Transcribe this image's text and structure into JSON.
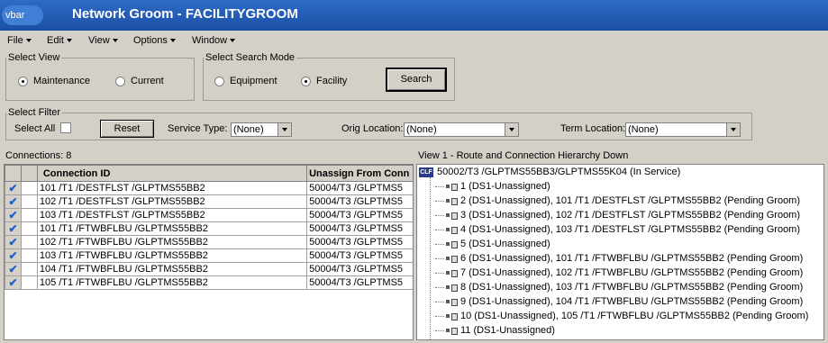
{
  "titlebar": {
    "app_badge": "vbar",
    "title": "Network Groom - FACILITYGROOM"
  },
  "menu": {
    "items": [
      "File",
      "Edit",
      "View",
      "Options",
      "Window"
    ]
  },
  "select_view": {
    "legend": "Select View",
    "options": [
      "Maintenance",
      "Current"
    ],
    "selected": "Maintenance"
  },
  "search_mode": {
    "legend": "Select Search Mode",
    "options": [
      "Equipment",
      "Facility"
    ],
    "selected": "Facility",
    "search_label": "Search"
  },
  "filter": {
    "legend": "Select Filter",
    "select_all_label": "Select All",
    "reset_label": "Reset",
    "service_type_label": "Service Type:",
    "service_type_value": "(None)",
    "orig_location_label": "Orig Location:",
    "orig_location_value": "(None)",
    "term_location_label": "Term Location:",
    "term_location_value": "(None)"
  },
  "connections": {
    "count_label": "Connections: 8",
    "columns": [
      "Connection ID",
      "Unassign From Conn"
    ],
    "rows": [
      [
        "101  /T1   /DESTFLST  /GLPTMS55BB2",
        "50004/T3    /GLPTMS5"
      ],
      [
        "102  /T1   /DESTFLST  /GLPTMS55BB2",
        "50004/T3    /GLPTMS5"
      ],
      [
        "103  /T1   /DESTFLST  /GLPTMS55BB2",
        "50004/T3    /GLPTMS5"
      ],
      [
        "101  /T1   /FTWBFLBU  /GLPTMS55BB2",
        "50004/T3    /GLPTMS5"
      ],
      [
        "102  /T1   /FTWBFLBU  /GLPTMS55BB2",
        "50004/T3    /GLPTMS5"
      ],
      [
        "103  /T1   /FTWBFLBU  /GLPTMS55BB2",
        "50004/T3    /GLPTMS5"
      ],
      [
        "104  /T1   /FTWBFLBU  /GLPTMS55BB2",
        "50004/T3    /GLPTMS5"
      ],
      [
        "105  /T1   /FTWBFLBU  /GLPTMS55BB2",
        "50004/T3    /GLPTMS5"
      ]
    ]
  },
  "hierarchy": {
    "caption": "View 1 - Route and Connection Hierarchy Down",
    "root_badge": "CLF",
    "root": "50002/T3    /GLPTMS55BB3/GLPTMS55K04 (In Service)",
    "items": [
      "1 (DS1-Unassigned)",
      "2 (DS1-Unassigned), 101  /T1    /DESTFLST    /GLPTMS55BB2 (Pending Groom)",
      "3 (DS1-Unassigned), 102  /T1    /DESTFLST    /GLPTMS55BB2 (Pending Groom)",
      "4 (DS1-Unassigned), 103  /T1    /DESTFLST    /GLPTMS55BB2 (Pending Groom)",
      "5 (DS1-Unassigned)",
      "6 (DS1-Unassigned), 101  /T1    /FTWBFLBU    /GLPTMS55BB2 (Pending Groom)",
      "7 (DS1-Unassigned), 102  /T1    /FTWBFLBU    /GLPTMS55BB2 (Pending Groom)",
      "8 (DS1-Unassigned), 103  /T1    /FTWBFLBU    /GLPTMS55BB2 (Pending Groom)",
      "9 (DS1-Unassigned), 104  /T1    /FTWBFLBU    /GLPTMS55BB2 (Pending Groom)",
      "10 (DS1-Unassigned), 105  /T1    /FTWBFLBU    /GLPTMS55BB2 (Pending Groom)",
      "11 (DS1-Unassigned)"
    ]
  },
  "colors": {
    "titlebar": "#1b4fa6",
    "window_bg": "#d4d0c8",
    "check": "#1a5fd0"
  }
}
